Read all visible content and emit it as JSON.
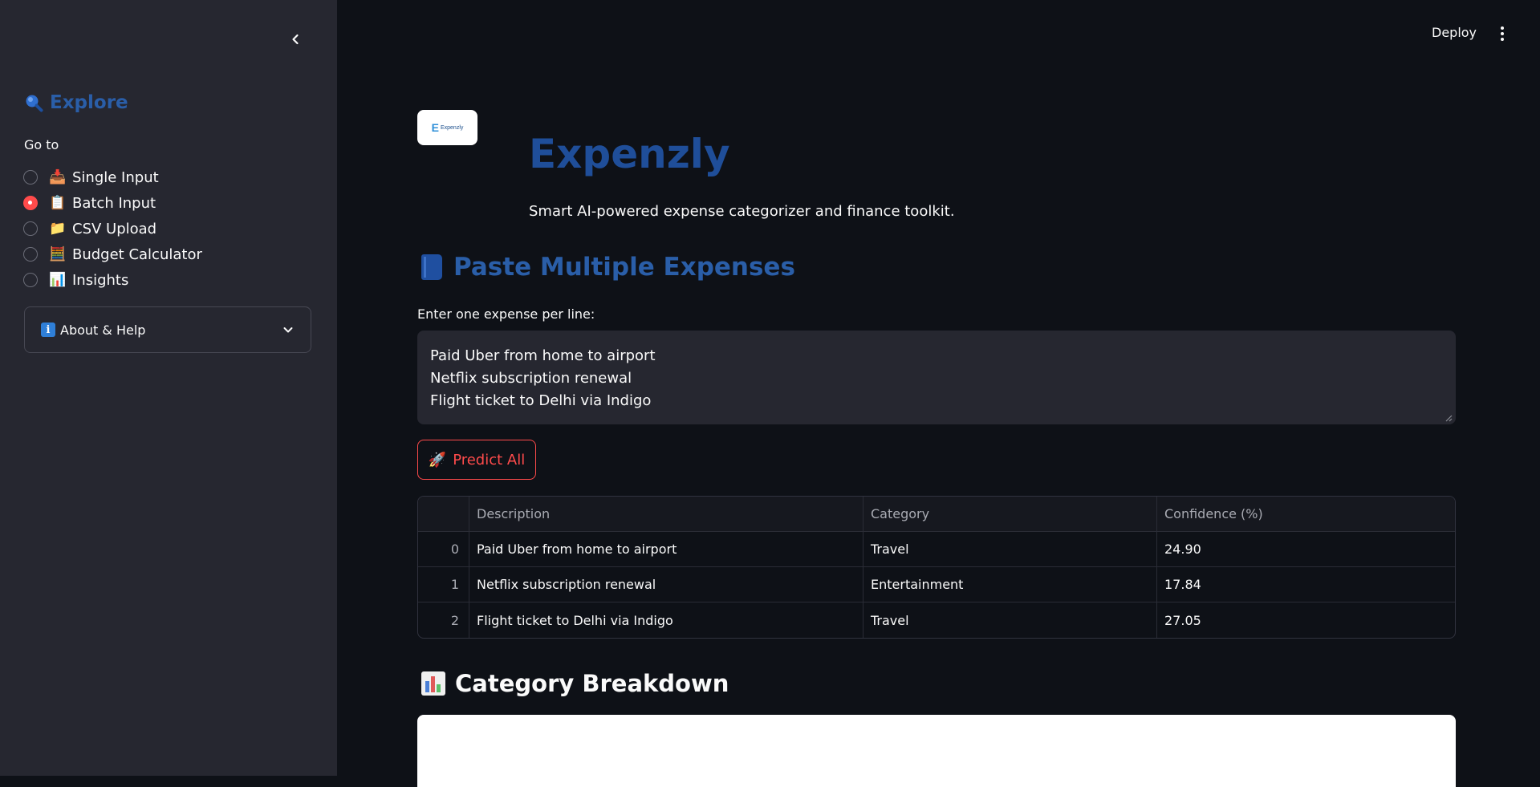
{
  "header": {
    "deploy_label": "Deploy"
  },
  "sidebar": {
    "heading": "Explore",
    "goto_label": "Go to",
    "nav": [
      {
        "label": "Single Input",
        "icon": "inbox-tray-icon",
        "emoji": "📥",
        "selected": false
      },
      {
        "label": "Batch Input",
        "icon": "clipboard-icon",
        "emoji": "📋",
        "selected": true
      },
      {
        "label": "CSV Upload",
        "icon": "folder-icon",
        "emoji": "📁",
        "selected": false
      },
      {
        "label": "Budget Calculator",
        "icon": "abacus-icon",
        "emoji": "🧮",
        "selected": false
      },
      {
        "label": "Insights",
        "icon": "bar-chart-icon",
        "emoji": "📊",
        "selected": false
      }
    ],
    "expander_label": "About & Help"
  },
  "main": {
    "logo_text": "Expenzly",
    "title": "Expenzly",
    "subtitle": "Smart AI-powered expense categorizer and finance toolkit.",
    "section_title": "Paste Multiple Expenses",
    "input_label": "Enter one expense per line:",
    "textarea_value": "Paid Uber from home to airport\nNetflix subscription renewal\nFlight ticket to Delhi via Indigo",
    "predict_label": "Predict All",
    "table": {
      "columns": [
        "",
        "Description",
        "Category",
        "Confidence (%)"
      ],
      "rows": [
        {
          "index": "0",
          "description": "Paid Uber from home to airport",
          "category": "Travel",
          "confidence": "24.90"
        },
        {
          "index": "1",
          "description": "Netflix subscription renewal",
          "category": "Entertainment",
          "confidence": "17.84"
        },
        {
          "index": "2",
          "description": "Flight ticket to Delhi via Indigo",
          "category": "Travel",
          "confidence": "27.05"
        }
      ]
    },
    "breakdown_title": "Category Breakdown"
  },
  "colors": {
    "accent": "#ff4b4b",
    "title_blue": "#1f4e99",
    "heading_blue": "#2a5ea8",
    "sidebar_bg": "#262730",
    "page_bg": "#0e1117"
  }
}
